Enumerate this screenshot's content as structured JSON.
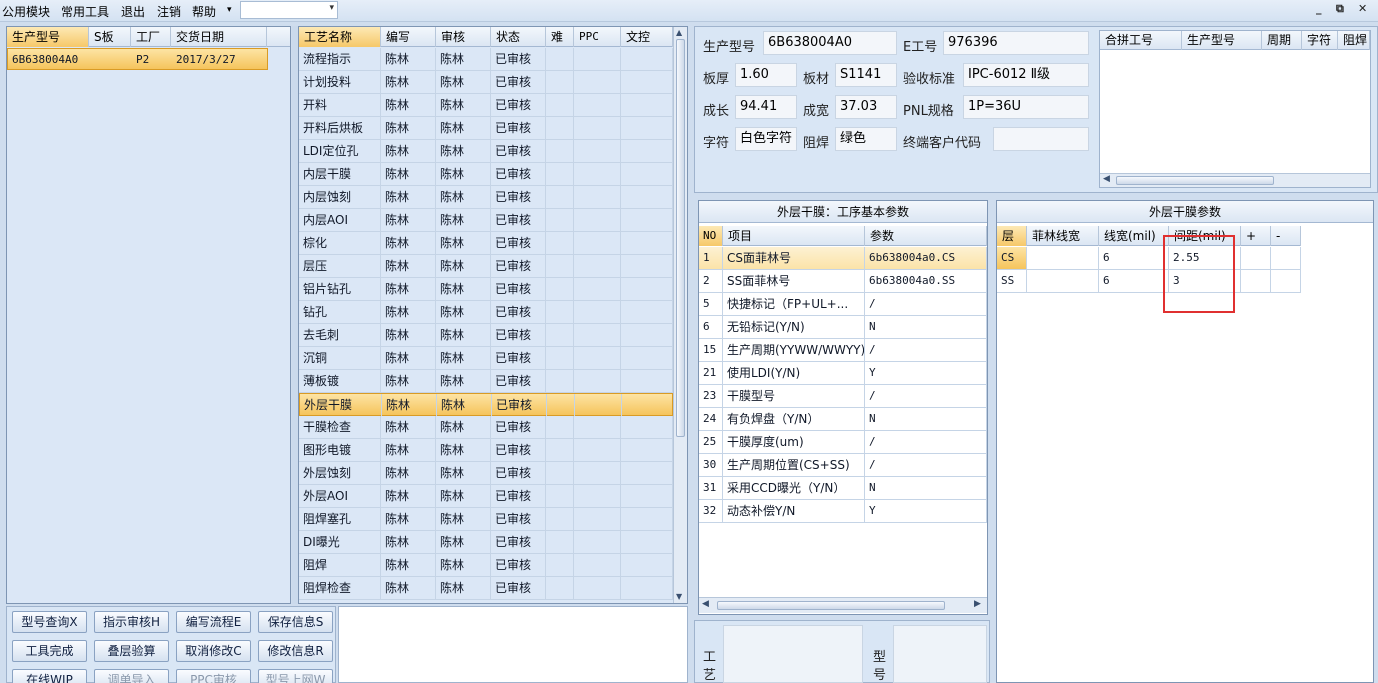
{
  "menu": {
    "items": [
      "公用模块",
      "常用工具",
      "退出",
      "注销",
      "帮助"
    ],
    "help_arrow": "▾",
    "combo_arrow": "▾",
    "window_controls": [
      "_",
      "⧉",
      "✕"
    ]
  },
  "orders": {
    "columns": [
      "生产型号",
      "S板",
      "工厂",
      "交货日期"
    ],
    "rows": [
      {
        "model": "6B638004A0",
        "s": "",
        "factory": "P2",
        "date": "2017/3/27"
      }
    ]
  },
  "process": {
    "columns": [
      "工艺名称",
      "编写",
      "审核",
      "状态",
      "难",
      "PPC",
      "文控"
    ],
    "rows": [
      [
        "流程指示",
        "陈林",
        "陈林",
        "已审核"
      ],
      [
        "计划投料",
        "陈林",
        "陈林",
        "已审核"
      ],
      [
        "开料",
        "陈林",
        "陈林",
        "已审核"
      ],
      [
        "开料后烘板",
        "陈林",
        "陈林",
        "已审核"
      ],
      [
        "LDI定位孔",
        "陈林",
        "陈林",
        "已审核"
      ],
      [
        "内层干膜",
        "陈林",
        "陈林",
        "已审核"
      ],
      [
        "内层蚀刻",
        "陈林",
        "陈林",
        "已审核"
      ],
      [
        "内层AOI",
        "陈林",
        "陈林",
        "已审核"
      ],
      [
        "棕化",
        "陈林",
        "陈林",
        "已审核"
      ],
      [
        "层压",
        "陈林",
        "陈林",
        "已审核"
      ],
      [
        "铝片钻孔",
        "陈林",
        "陈林",
        "已审核"
      ],
      [
        "钻孔",
        "陈林",
        "陈林",
        "已审核"
      ],
      [
        "去毛刺",
        "陈林",
        "陈林",
        "已审核"
      ],
      [
        "沉铜",
        "陈林",
        "陈林",
        "已审核"
      ],
      [
        "薄板镀",
        "陈林",
        "陈林",
        "已审核"
      ],
      [
        "外层干膜",
        "陈林",
        "陈林",
        "已审核"
      ],
      [
        "干膜检查",
        "陈林",
        "陈林",
        "已审核"
      ],
      [
        "图形电镀",
        "陈林",
        "陈林",
        "已审核"
      ],
      [
        "外层蚀刻",
        "陈林",
        "陈林",
        "已审核"
      ],
      [
        "外层AOI",
        "陈林",
        "陈林",
        "已审核"
      ],
      [
        "阻焊塞孔",
        "陈林",
        "陈林",
        "已审核"
      ],
      [
        "DI曝光",
        "陈林",
        "陈林",
        "已审核"
      ],
      [
        "阻焊",
        "陈林",
        "陈林",
        "已审核"
      ],
      [
        "阻焊检查",
        "陈林",
        "陈林",
        "已审核"
      ]
    ],
    "selected_index": 15
  },
  "buttons": [
    [
      "型号查询X",
      "指示审核H",
      "编写流程E",
      "保存信息S"
    ],
    [
      "工具完成",
      "叠层验算",
      "取消修改C",
      "修改信息R"
    ],
    [
      "在线WIP",
      "调单导入",
      "PPC审核",
      "型号上网W"
    ]
  ],
  "info": {
    "model_label": "生产型号",
    "model": "6B638004A0",
    "eno_label": "E工号",
    "eno": "976396",
    "thick_label": "板厚",
    "thick": "1.60",
    "material_label": "板材",
    "material": "S1141",
    "std_label": "验收标准",
    "std": "IPC-6012 Ⅱ级",
    "len_label": "成长",
    "len": "94.41",
    "wid_label": "成宽",
    "wid": "37.03",
    "pnl_label": "PNL规格",
    "pnl": "1P=36U",
    "char_label": "字符",
    "char": "白色字符",
    "mask_label": "阻焊",
    "mask": "绿色",
    "cust_label": "终端客户代码",
    "cust": ""
  },
  "merge": {
    "columns": [
      "合拼工号",
      "生产型号",
      "周期",
      "字符",
      "阻焊"
    ]
  },
  "basic": {
    "title": "外层干膜：工序基本参数",
    "columns": [
      "NO",
      "项目",
      "参数"
    ],
    "rows": [
      [
        "1",
        "CS面菲林号",
        "6b638004a0.CS"
      ],
      [
        "2",
        "SS面菲林号",
        "6b638004a0.SS"
      ],
      [
        "5",
        "快捷标记（FP+UL+...",
        "/"
      ],
      [
        "6",
        "无铅标记(Y/N)",
        "N"
      ],
      [
        "15",
        "生产周期(YYWW/WWYY)",
        "/"
      ],
      [
        "21",
        "使用LDI(Y/N)",
        "Y"
      ],
      [
        "23",
        "干膜型号",
        "/"
      ],
      [
        "24",
        "有负焊盘（Y/N）",
        "N"
      ],
      [
        "25",
        "干膜厚度(um)",
        "/"
      ],
      [
        "30",
        "生产周期位置(CS+SS)",
        "/"
      ],
      [
        "31",
        "采用CCD曝光（Y/N）",
        "N"
      ],
      [
        "32",
        "动态补偿Y/N",
        "Y"
      ]
    ]
  },
  "film": {
    "title": "外层干膜参数",
    "columns": [
      "层",
      "菲林线宽",
      "线宽(mil)",
      "间距(mil)",
      "+",
      "-"
    ],
    "rows": [
      [
        "CS",
        "",
        "6",
        "2.55",
        "",
        ""
      ],
      [
        "SS",
        "",
        "6",
        "3",
        "",
        ""
      ]
    ]
  },
  "bottom": {
    "left_label": "工艺",
    "right_label": "型号"
  },
  "colors": {
    "selection": "#f5c45c",
    "accent_border": "#7e95b3",
    "highlight_box": "#e03030"
  }
}
